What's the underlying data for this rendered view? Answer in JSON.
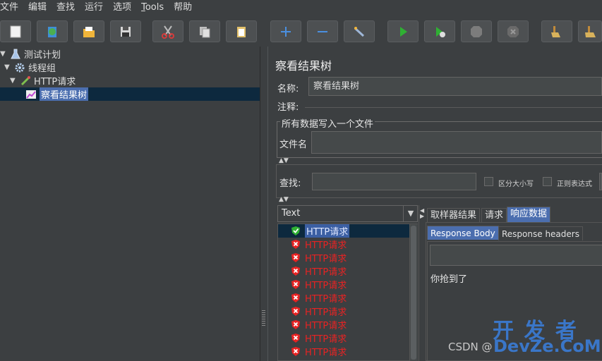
{
  "menu": [
    "文件",
    "编辑",
    "查找",
    "运行",
    "选项",
    "Tools",
    "帮助"
  ],
  "toolbar": {
    "buttons": [
      {
        "name": "new-icon",
        "color": "#f2f2f2"
      },
      {
        "name": "templates-icon",
        "color": "#4caf50"
      },
      {
        "name": "open-icon",
        "color": "#f1b53a"
      },
      {
        "name": "save-icon",
        "color": "#d6d6d6"
      },
      {
        "name": "cut-icon",
        "color": "#d73a3a"
      },
      {
        "name": "copy-icon",
        "color": "#e0e0e0"
      },
      {
        "name": "paste-icon",
        "color": "#e2c06a"
      },
      {
        "name": "expand-icon",
        "color": "#4a8fe0"
      },
      {
        "name": "collapse-icon",
        "color": "#4a8fe0"
      },
      {
        "name": "toggle-icon",
        "color": "#9fb7d8"
      },
      {
        "name": "start-icon",
        "color": "#2fb033"
      },
      {
        "name": "start-no-pause-icon",
        "color": "#2fb033"
      },
      {
        "name": "stop-icon",
        "color": "#7c7c7c"
      },
      {
        "name": "shutdown-icon",
        "color": "#7c7c7c"
      },
      {
        "name": "clear-icon",
        "color": "#d8b25c"
      },
      {
        "name": "clear-all-icon",
        "color": "#d8b25c"
      }
    ]
  },
  "tree": {
    "items": [
      {
        "label": "测试计划",
        "level": 0,
        "icon": "flask-icon"
      },
      {
        "label": "线程组",
        "level": 1,
        "icon": "gear-icon"
      },
      {
        "label": "HTTP请求",
        "level": 2,
        "icon": "pipette-icon"
      },
      {
        "label": "察看结果树",
        "level": 3,
        "icon": "chart-icon"
      }
    ]
  },
  "panel": {
    "title": "察看结果树",
    "name_label": "名称:",
    "name_value": "察看结果树",
    "comment_label": "注释:",
    "group_title": "所有数据写入一个文件",
    "filename_label": "文件名",
    "search_label": "查找:",
    "case_label": "区分大小写",
    "regex_label": "正则表达式",
    "renderer_value": "Text"
  },
  "results": {
    "items": [
      {
        "label": "HTTP请求",
        "status": "success"
      },
      {
        "label": "HTTP请求",
        "status": "error"
      },
      {
        "label": "HTTP请求",
        "status": "error"
      },
      {
        "label": "HTTP请求",
        "status": "error"
      },
      {
        "label": "HTTP请求",
        "status": "error"
      },
      {
        "label": "HTTP请求",
        "status": "error"
      },
      {
        "label": "HTTP请求",
        "status": "error"
      },
      {
        "label": "HTTP请求",
        "status": "error"
      },
      {
        "label": "HTTP请求",
        "status": "error"
      },
      {
        "label": "HTTP请求",
        "status": "error"
      }
    ]
  },
  "detail_tabs": [
    "取样器结果",
    "请求",
    "响应数据"
  ],
  "response_tabs": [
    "Response Body",
    "Response headers"
  ],
  "response_text": "你抢到了",
  "watermark": {
    "csdn": "CSDN @",
    "brand_cn": "开 发 者",
    "brand_en": "DevZe.CoM"
  },
  "colors": {
    "success": "#2fb033",
    "error": "#e82323",
    "selection": "#0d293e",
    "accent": "#4b6eaf"
  }
}
